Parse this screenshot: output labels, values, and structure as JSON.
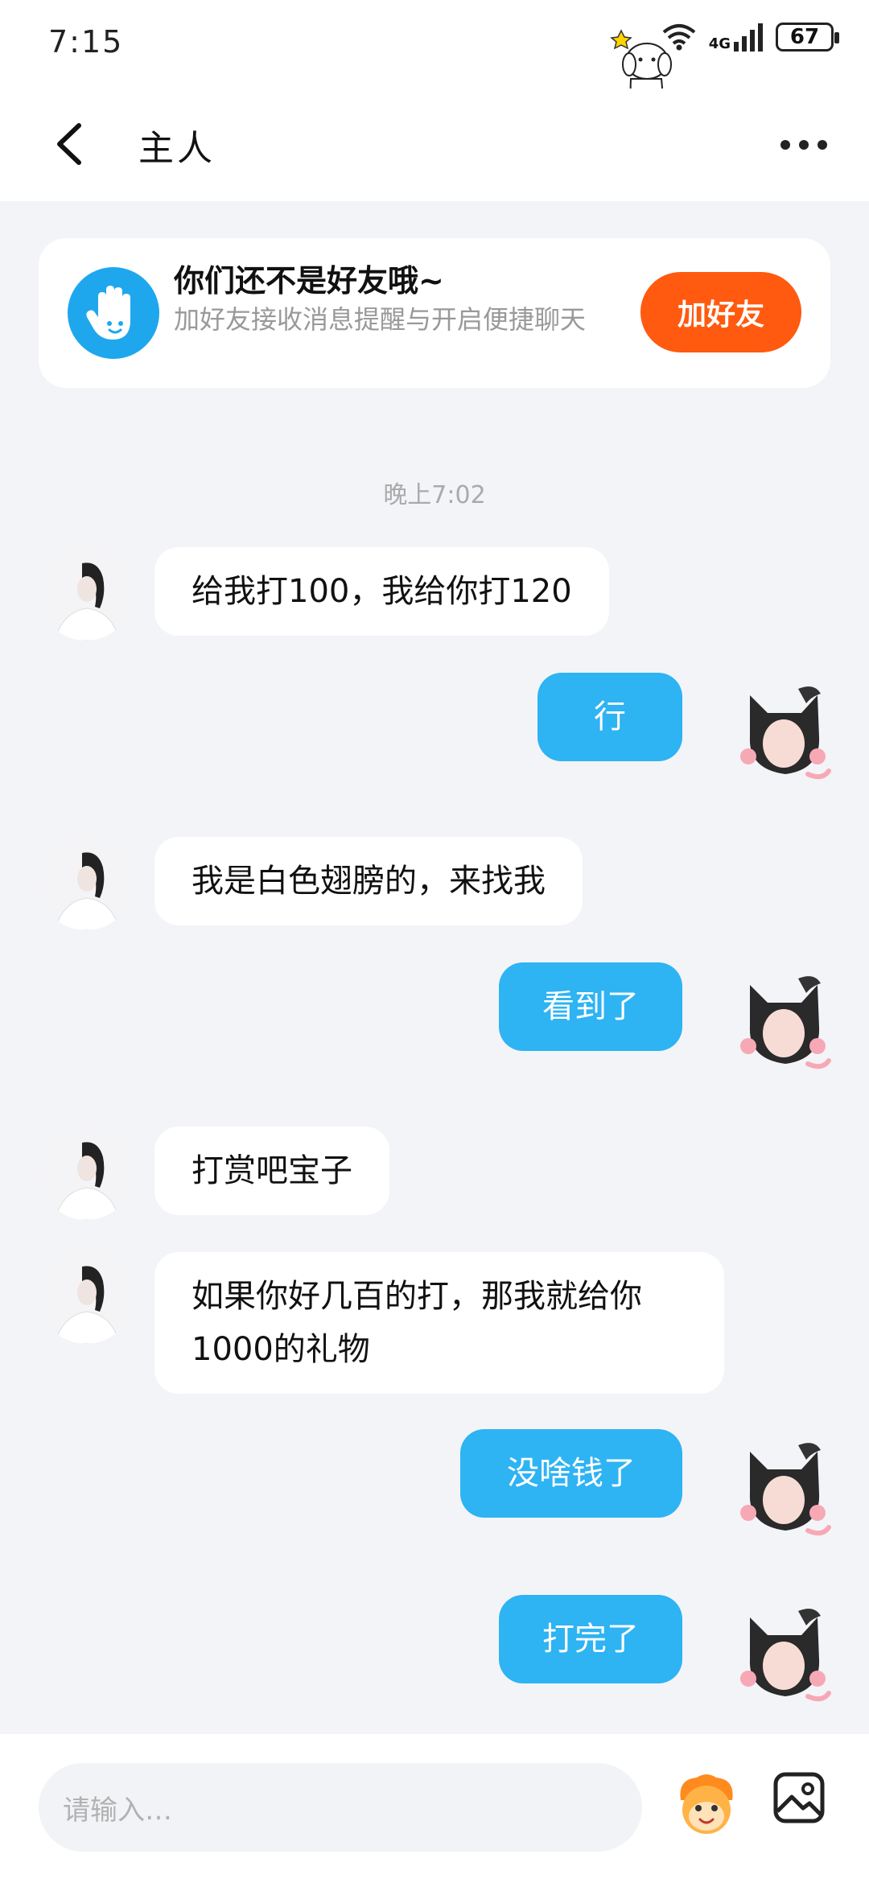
{
  "status_bar": {
    "time": "7:15",
    "network": "4G",
    "battery": "67"
  },
  "header": {
    "title": "主人"
  },
  "friend_card": {
    "title": "你们还不是好友哦~",
    "subtitle": "加好友接收消息提醒与开启便捷聊天",
    "button": "加好友"
  },
  "timestamp": "晚上7:02",
  "messages": [
    {
      "side": "left",
      "text": "给我打100，我给你打120"
    },
    {
      "side": "right",
      "text": "行"
    },
    {
      "side": "left",
      "text": "我是白色翅膀的，来找我"
    },
    {
      "side": "right",
      "text": "看到了"
    },
    {
      "side": "left",
      "text": "打赏吧宝子"
    },
    {
      "side": "left",
      "text": "如果你好几百的打，那我就给你1000的礼物"
    },
    {
      "side": "right",
      "text": "没啥钱了"
    },
    {
      "side": "right",
      "text": "打完了"
    }
  ],
  "input": {
    "placeholder": "请输入…"
  },
  "colors": {
    "accent": "#2eb3f3",
    "add_button": "#ff5a0f",
    "background": "#f3f4f8"
  }
}
